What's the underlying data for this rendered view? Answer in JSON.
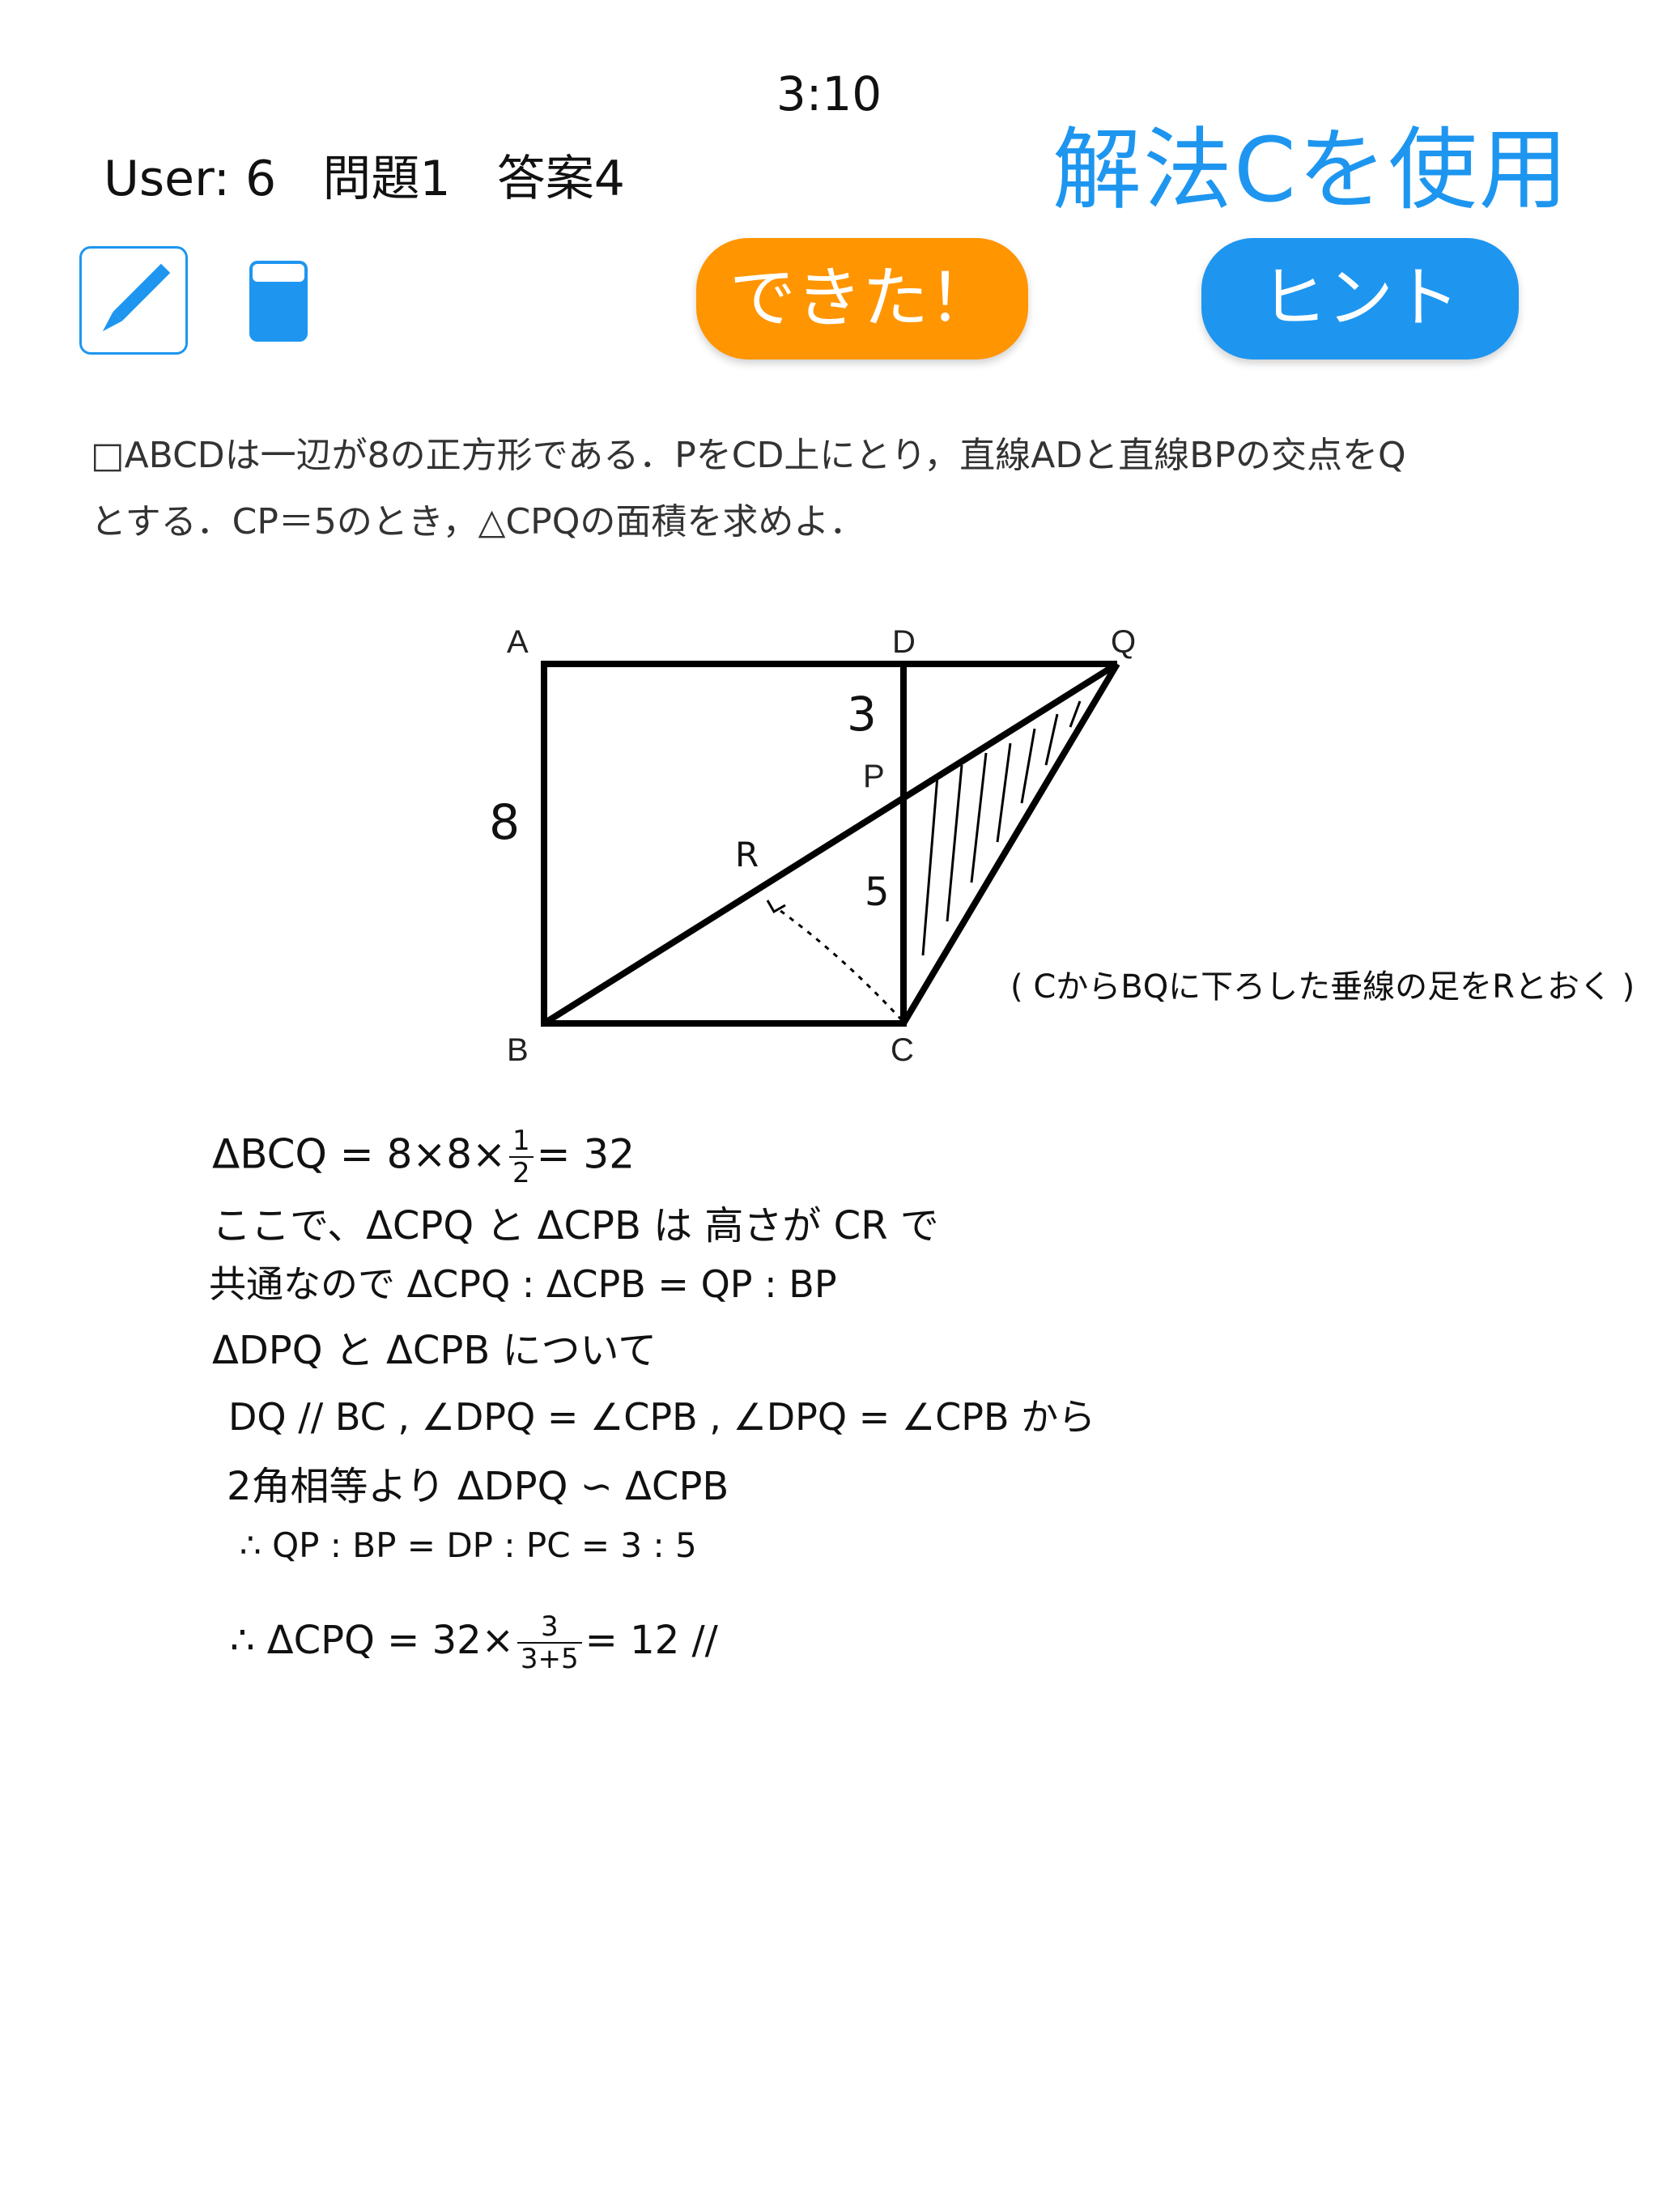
{
  "header": {
    "timer": "3:10",
    "user_info": "User: 6   問題1   答案4",
    "method": "解法Cを使用"
  },
  "toolbar": {
    "pencil_icon": "pencil-icon",
    "eraser_icon": "eraser-icon",
    "done_label": "できた！",
    "hint_label": "ヒント"
  },
  "colors": {
    "accent_blue": "#1e96f0",
    "done_orange": "#ff9500"
  },
  "problem": {
    "line1": "□ABCDは一辺が8の正方形である．PをCD上にとり，直線ADと直線BPの交点をQ",
    "line2": "とする．CP＝5のとき，△CPQの面積を求めよ．"
  },
  "diagram": {
    "labels": {
      "A": "A",
      "D": "D",
      "Q": "Q",
      "P": "P",
      "B": "B",
      "C": "C"
    },
    "annotations": {
      "side": "8",
      "dp": "3",
      "pc": "5",
      "r": "R",
      "note": "( CからBQに下ろした垂線の足をRとおく )"
    }
  },
  "solution": {
    "l1_a": "ΔBCQ = 8×8×",
    "l1_num": "1",
    "l1_den": "2",
    "l1_b": "= 32",
    "l2": "ここで、ΔCPQ と ΔCPB は 高さが CR で",
    "l3": "共通なので  ΔCPQ : ΔCPB = QP : BP",
    "l4": "ΔDPQ と ΔCPB について",
    "l5": "DQ // BC , ∠DPQ = ∠CPB , ∠DPQ = ∠CPB から",
    "l6": "2角相等より   ΔDPQ ∽ ΔCPB",
    "l7": "∴ QP : BP = DP : PC = 3 : 5",
    "l8_a": "∴ ΔCPQ = 32×",
    "l8_num": "3",
    "l8_den": "3+5",
    "l8_b": "= 12 //"
  }
}
